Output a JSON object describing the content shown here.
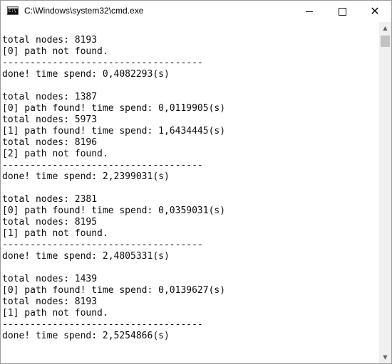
{
  "window": {
    "title": "C:\\Windows\\system32\\cmd.exe",
    "icon": "cmd-icon",
    "controls": {
      "minimize": "minimize-icon",
      "maximize": "maximize-icon",
      "close_glyph": "✕"
    }
  },
  "console": {
    "lines": [
      "total nodes: 8193",
      "[0] path not found.",
      "------------------------------------",
      "done! time spend: 0,4082293(s)",
      "",
      "total nodes: 1387",
      "[0] path found! time spend: 0,0119905(s)",
      "total nodes: 5973",
      "[1] path found! time spend: 1,6434445(s)",
      "total nodes: 8196",
      "[2] path not found.",
      "------------------------------------",
      "done! time spend: 2,2399031(s)",
      "",
      "total nodes: 2381",
      "[0] path found! time spend: 0,0359031(s)",
      "total nodes: 8195",
      "[1] path not found.",
      "------------------------------------",
      "done! time spend: 2,4805331(s)",
      "",
      "total nodes: 1439",
      "[0] path found! time spend: 0,0139627(s)",
      "total nodes: 8193",
      "[1] path not found.",
      "------------------------------------",
      "done! time spend: 2,5254866(s)"
    ]
  },
  "scrollbar": {
    "up_glyph": "▲",
    "down_glyph": "▼"
  }
}
